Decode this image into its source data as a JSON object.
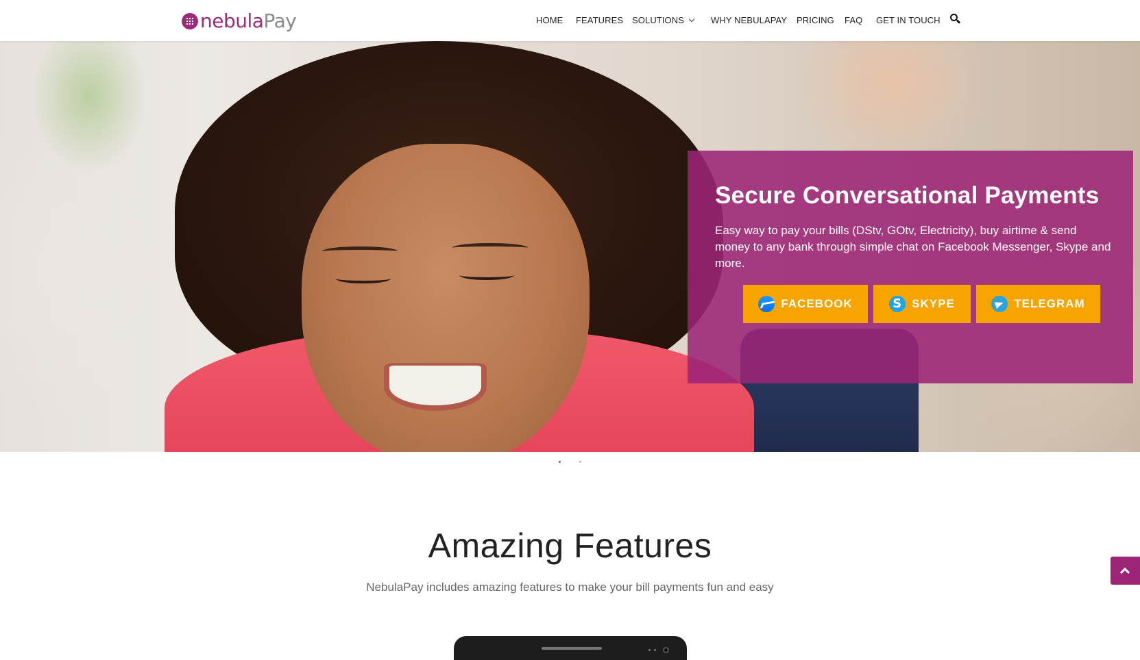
{
  "header": {
    "logo": {
      "part1": "nebula",
      "part2": "Pay"
    },
    "nav": [
      {
        "label": "HOME"
      },
      {
        "label": "FEATURES"
      },
      {
        "label": "SOLUTIONS"
      },
      {
        "label": "WHY NEBULAPAY"
      },
      {
        "label": "PRICING"
      },
      {
        "label": "FAQ"
      },
      {
        "label": "GET IN TOUCH"
      }
    ],
    "search_icon": "search-icon"
  },
  "hero": {
    "title": "Secure Conversational Payments",
    "description": "Easy way to pay your bills (DStv, GOtv, Electricity), buy airtime & send money to any bank through simple chat on Facebook Messenger, Skype and more.",
    "buttons": [
      {
        "label": "FACEBOOK",
        "icon": "messenger-icon"
      },
      {
        "label": "SKYPE",
        "icon": "skype-icon"
      },
      {
        "label": "TELEGRAM",
        "icon": "telegram-icon"
      }
    ],
    "slides_count": 2,
    "active_slide": 1
  },
  "features": {
    "title": "Amazing Features",
    "subtitle": "NebulaPay includes amazing features to make your bill payments fun and easy"
  },
  "colors": {
    "brand": "#9c2675",
    "button": "#f7a400"
  }
}
